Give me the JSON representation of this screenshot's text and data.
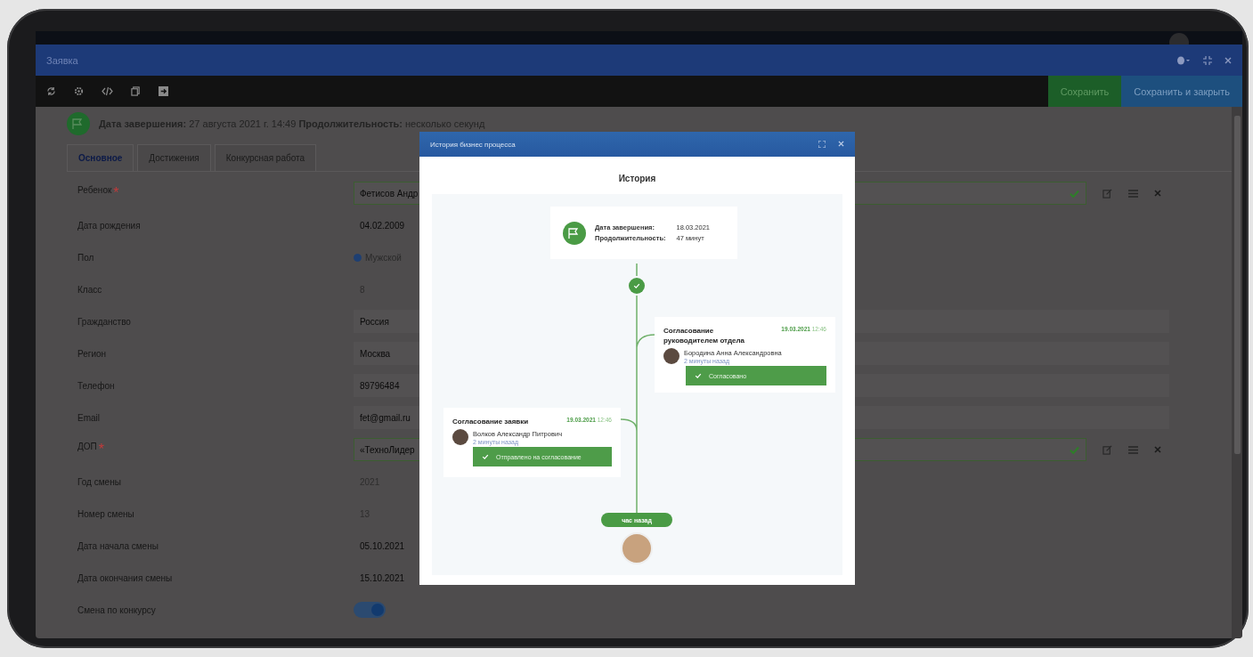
{
  "window": {
    "title": "Заявка"
  },
  "toolbar": {
    "buttons": [
      {
        "label": "Сохранить",
        "kind": "primary"
      },
      {
        "label": "Сохранить и закрыть",
        "kind": "secondary"
      }
    ]
  },
  "header": {
    "parts": [
      {
        "label": "Дата завершения:",
        "value": "27 августа 2021 г. 14:49"
      },
      {
        "label": "Продолжительность:",
        "value": "несколько секунд"
      }
    ]
  },
  "tabs": [
    {
      "label": "Основное",
      "selected": true
    },
    {
      "label": "Достижения",
      "selected": false
    },
    {
      "label": "Конкурсная работа",
      "selected": false
    }
  ],
  "form": [
    {
      "label": "Ребенок",
      "required_mark": "*",
      "kind": "lookup",
      "value": "Фетисов Андр"
    },
    {
      "label": "Дата рождения",
      "kind": "date",
      "value": "04.02.2009"
    },
    {
      "label": "Пол",
      "kind": "radio",
      "value": "Мужской",
      "selected": true
    },
    {
      "label": "Класс",
      "kind": "text",
      "value": "8",
      "disabled": true
    },
    {
      "label": "Гражданство",
      "kind": "text",
      "value": "Россия",
      "disabled": false
    },
    {
      "label": "Регион",
      "kind": "text",
      "value": "Москва",
      "disabled": false
    },
    {
      "label": "Телефон",
      "kind": "text",
      "value": "89796484",
      "disabled": false
    },
    {
      "label": "Email",
      "kind": "text",
      "value": "fet@gmail.ru",
      "disabled": false
    },
    {
      "label": "ДОП",
      "required_mark": "*",
      "kind": "lookup",
      "value": "«ТехноЛидер"
    },
    {
      "label": "Год смены",
      "kind": "text",
      "value": "2021",
      "disabled": true
    },
    {
      "label": "Номер смены",
      "kind": "text",
      "value": "13",
      "disabled": true
    },
    {
      "label": "Дата начала смены",
      "kind": "date",
      "value": "05.10.2021"
    },
    {
      "label": "Дата окончания смены",
      "kind": "date",
      "value": "15.10.2021"
    },
    {
      "label": "Смена по конкурсу",
      "kind": "toggle",
      "on": true
    }
  ],
  "modal": {
    "title": "История бизнес процесса",
    "heading": "История",
    "summary": {
      "rows": [
        {
          "label": "Дата завершения:",
          "value": "18.03.2021"
        },
        {
          "label": "Продолжительность:",
          "value": "47 минут"
        }
      ]
    },
    "steps": [
      {
        "title": "Согласование руководителем отдела",
        "date": "19.03.2021",
        "time": "12:46",
        "person": "Бородина Анна Александровна",
        "ago": "2 минуты назад",
        "status": "Согласовано"
      },
      {
        "title": "Согласование заявки",
        "date": "19.03.2021",
        "time": "12:46",
        "person": "Волков Александр Питрович",
        "ago": "2 минуты назад",
        "status": "Отправлено на согласование"
      }
    ],
    "start": "час назад"
  }
}
